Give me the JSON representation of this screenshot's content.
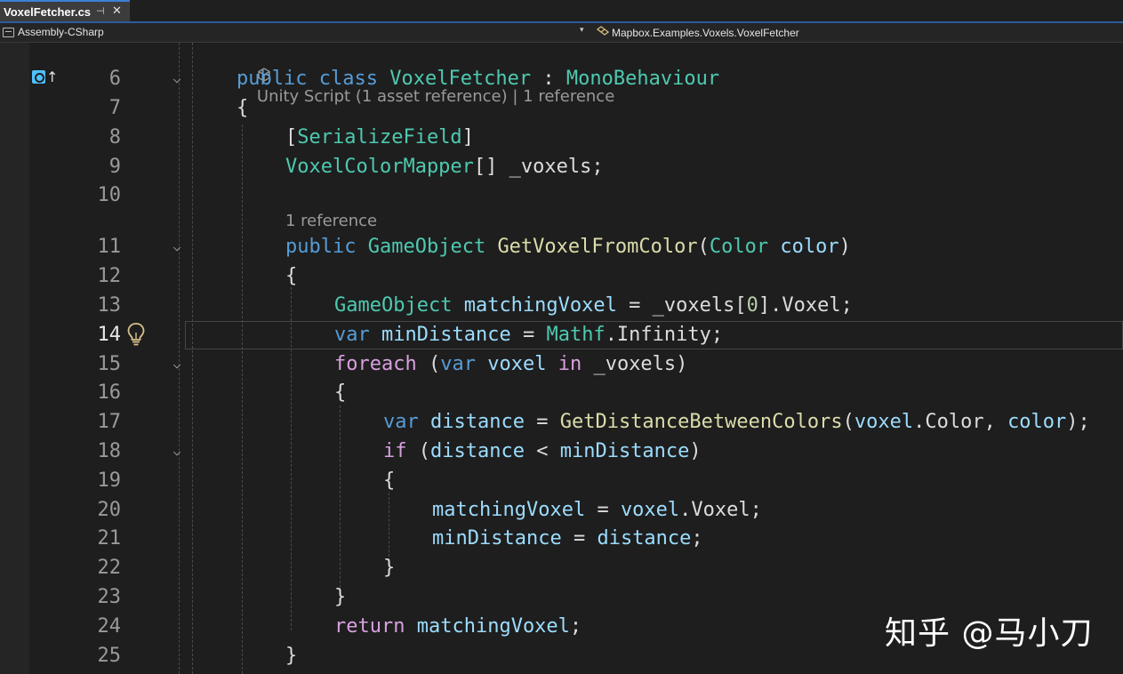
{
  "tab": {
    "title": "VoxelFetcher.cs",
    "pin_glyph": "⊣",
    "close_glyph": "✕"
  },
  "nav": {
    "project": "Assembly-CSharp",
    "dropdown_glyph": "▾",
    "member": "Mapbox.Examples.Voxels.VoxelFetcher"
  },
  "lens": {
    "class_refs": "Unity Script (1 asset reference) | 1 reference",
    "method_refs": "1 reference"
  },
  "line_numbers": [
    "6",
    "7",
    "8",
    "9",
    "10",
    "11",
    "12",
    "13",
    "14",
    "15",
    "16",
    "17",
    "18",
    "19",
    "20",
    "21",
    "22",
    "23",
    "24",
    "25"
  ],
  "code": {
    "l6": {
      "t1": "public",
      "t2": "class",
      "t3": "VoxelFetcher",
      "t4": ":",
      "t5": "MonoBehaviour"
    },
    "l7": {
      "t1": "{"
    },
    "l8": {
      "t1": "[",
      "t2": "SerializeField",
      "t3": "]"
    },
    "l9": {
      "t1": "VoxelColorMapper",
      "t2": "[]",
      "t3": "_voxels",
      "t4": ";"
    },
    "l11": {
      "t1": "public",
      "t2": "GameObject",
      "t3": "GetVoxelFromColor",
      "t4": "(",
      "t5": "Color",
      "t6": "color",
      "t7": ")"
    },
    "l12": {
      "t1": "{"
    },
    "l13": {
      "t1": "GameObject",
      "t2": "matchingVoxel",
      "t3": "=",
      "t4": "_voxels",
      "t5": "[",
      "t6": "0",
      "t7": "].Voxel;"
    },
    "l14": {
      "t1": "var",
      "t2": "minDistance",
      "t3": "=",
      "t4": "Mathf",
      "t5": ".Infinity;"
    },
    "l15": {
      "t1": "foreach",
      "t2": "(",
      "t3": "var",
      "t4": "voxel",
      "t5": "in",
      "t6": "_voxels",
      "t7": ")"
    },
    "l16": {
      "t1": "{"
    },
    "l17": {
      "t1": "var",
      "t2": "distance",
      "t3": "=",
      "t4": "GetDistanceBetweenColors",
      "t5": "(",
      "t6": "voxel",
      "t7": ".Color,",
      "t8": "color",
      "t9": ");"
    },
    "l18": {
      "t1": "if",
      "t2": "(",
      "t3": "distance",
      "t4": "<",
      "t5": "minDistance",
      "t6": ")"
    },
    "l19": {
      "t1": "{"
    },
    "l20": {
      "t1": "matchingVoxel",
      "t2": "=",
      "t3": "voxel",
      "t4": ".Voxel;"
    },
    "l21": {
      "t1": "minDistance",
      "t2": "=",
      "t3": "distance",
      "t4": ";"
    },
    "l22": {
      "t1": "}"
    },
    "l23": {
      "t1": "}"
    },
    "l24": {
      "t1": "return",
      "t2": "matchingVoxel",
      "t3": ";"
    },
    "l25": {
      "t1": "}"
    }
  },
  "fold_glyph": "⌵",
  "watermark": "知乎 @马小刀",
  "colors": {
    "keyword": "#569cd6",
    "control": "#d8a0df",
    "type": "#4ec9b0",
    "method": "#dcdcaa",
    "variable": "#9cdcfe",
    "number": "#b5cea8",
    "background": "#1e1e1e"
  }
}
